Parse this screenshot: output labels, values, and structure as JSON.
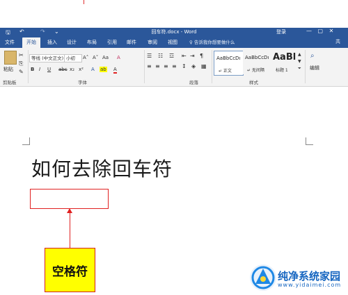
{
  "window": {
    "title": "回车符.docx - Word",
    "login": "登录",
    "minimize": "—",
    "restore": "▢",
    "close": "✕"
  },
  "quick_access": {
    "save": "🖫",
    "undo": "↶",
    "redo": "↷",
    "more": "⌄"
  },
  "tabs": [
    "文件",
    "开始",
    "插入",
    "设计",
    "布局",
    "引用",
    "邮件",
    "审阅",
    "视图"
  ],
  "active_tab": "开始",
  "tell_me": "♀ 告诉我你想要做什么",
  "share": "共",
  "ribbon": {
    "clipboard": {
      "label": "剪贴板",
      "paste": "粘贴"
    },
    "font": {
      "label": "字体",
      "font_name": "等线 (中文正文)",
      "font_size": "小初",
      "bold": "B",
      "italic": "I",
      "underline": "U",
      "strike": "abc",
      "subscript": "x₂",
      "superscript": "x²",
      "grow": "A˄",
      "shrink": "A˅",
      "case": "Aa",
      "clear": "A",
      "font_color": "A",
      "highlight": "ab"
    },
    "paragraph": {
      "label": "段落"
    },
    "styles": {
      "label": "样式",
      "cards": [
        {
          "sample": "AaBbCcDı",
          "name": "↵ 正文"
        },
        {
          "sample": "AaBbCcDı",
          "name": "↵ 无间隔"
        },
        {
          "sample": "AaBl",
          "name": "标题 1"
        }
      ]
    },
    "editing": {
      "label": "编辑",
      "find": "⌕"
    }
  },
  "document": {
    "heading": "如何去除回车符",
    "annotation_label": "空格符"
  },
  "watermark": {
    "text": "纯净系统家园",
    "url": "www.yidaimei.com"
  },
  "colors": {
    "accent": "#2b579a",
    "annotation_red": "#e02020",
    "annotation_yellow": "#ffff00",
    "watermark_blue": "#1565c0"
  }
}
